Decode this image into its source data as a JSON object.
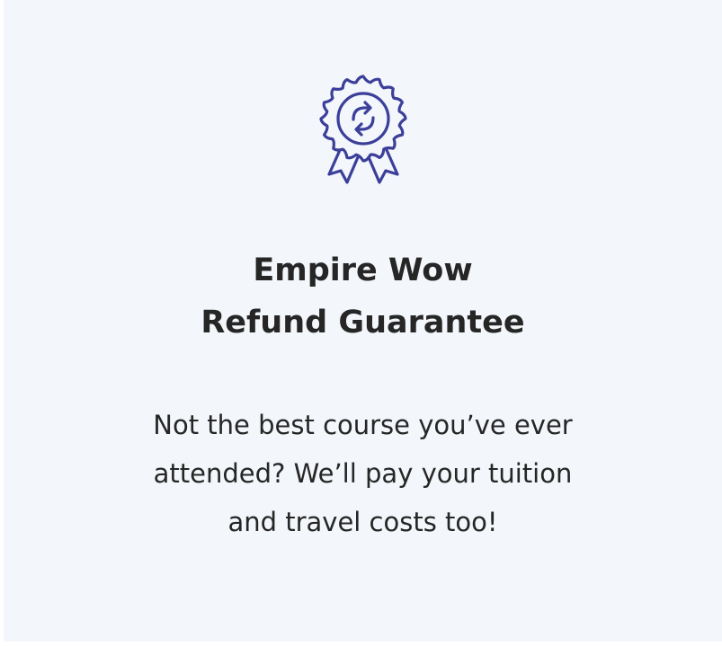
{
  "card": {
    "icon": "award-badge-refresh-icon",
    "accent_color": "#3b3f9a",
    "title_lines": [
      "Empire Wow",
      "Refund Guarantee"
    ],
    "description_lines": [
      "Not the best course you’ve ever",
      "attended? We’ll pay your tuition",
      "and travel costs too!"
    ]
  }
}
